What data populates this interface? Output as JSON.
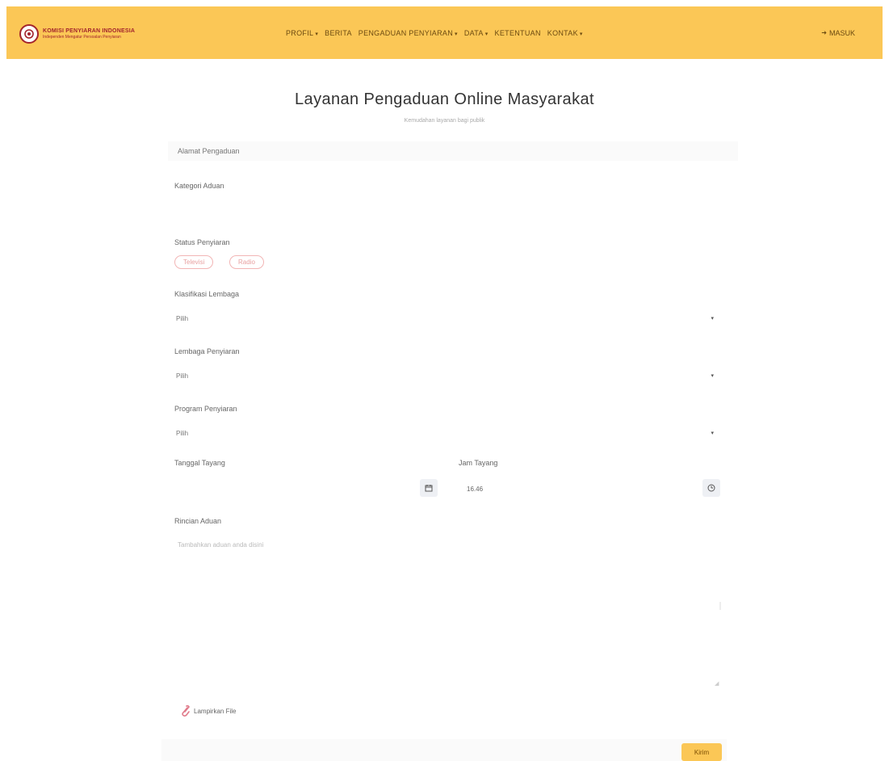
{
  "brand": {
    "name": "KOMISI PENYIARAN INDONESIA",
    "tagline": "Independen Mengatur Persoalan Penyiaran",
    "color": "#fbc756",
    "logo_color": "#a3242c"
  },
  "nav": {
    "items": [
      {
        "label": "PROFIL",
        "dropdown": true
      },
      {
        "label": "BERITA",
        "dropdown": false
      },
      {
        "label": "PENGADUAN PENYIARAN",
        "dropdown": true
      },
      {
        "label": "DATA",
        "dropdown": true
      },
      {
        "label": "KETENTUAN",
        "dropdown": false
      },
      {
        "label": "KONTAK",
        "dropdown": true
      }
    ],
    "caret": "▾",
    "login_label": "MASUK",
    "login_icon": "login-icon"
  },
  "page": {
    "title": "Layanan Pengaduan Online Masyarakat",
    "subtitle": "Kemudahan layanan bagi publik"
  },
  "form": {
    "email": {
      "placeholder": "Alamat Pengaduan"
    },
    "category": {
      "label": "Kategori Aduan"
    },
    "broadcast_status": {
      "label": "Status Penyiaran",
      "options": [
        "Televisi",
        "Radio"
      ]
    },
    "classification": {
      "label": "Klasifikasi Lembaga",
      "value": "Pilih"
    },
    "institution": {
      "label": "Lembaga Penyiaran",
      "value": "Pilih"
    },
    "program": {
      "label": "Program Penyiaran",
      "value": "Pilih"
    },
    "air_date": {
      "label": "Tanggal Tayang",
      "value": "",
      "icon": "calendar-icon"
    },
    "air_time": {
      "label": "Jam Tayang",
      "value": "16.46",
      "icon": "clock-icon"
    },
    "content": {
      "label": "Rincian Aduan",
      "placeholder": "Tambahkan aduan anda disini"
    },
    "attachment": {
      "label": "Lampirkan File",
      "icon": "paperclip-icon"
    },
    "submit_label": "Kirim"
  }
}
